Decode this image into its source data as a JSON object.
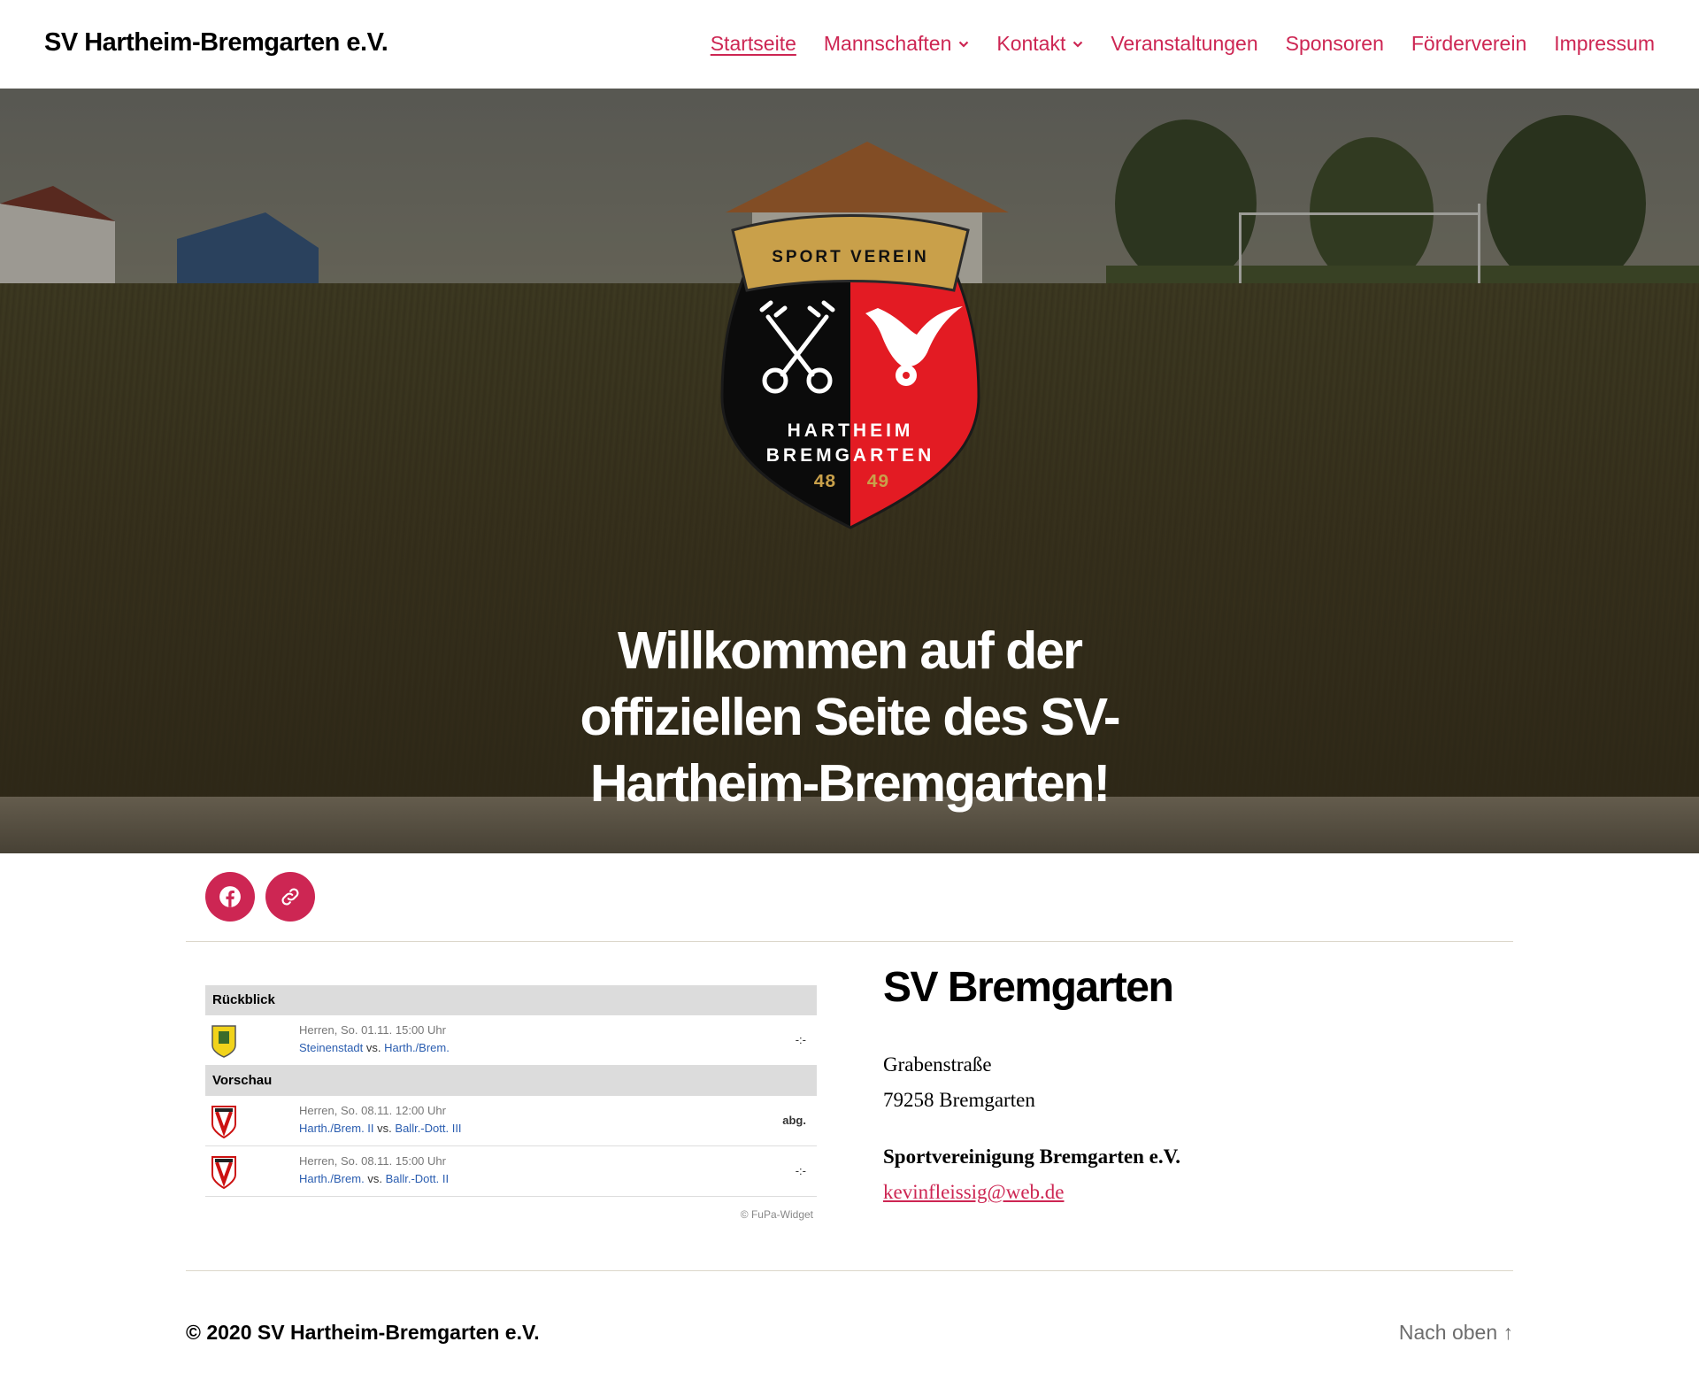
{
  "header": {
    "site_title": "SV Hartheim-Bremgarten e.V.",
    "nav": [
      {
        "label": "Startseite",
        "current": true,
        "dropdown": false
      },
      {
        "label": "Mannschaften",
        "current": false,
        "dropdown": true
      },
      {
        "label": "Kontakt",
        "current": false,
        "dropdown": true
      },
      {
        "label": "Veranstaltungen",
        "current": false,
        "dropdown": false
      },
      {
        "label": "Sponsoren",
        "current": false,
        "dropdown": false
      },
      {
        "label": "Förderverein",
        "current": false,
        "dropdown": false
      },
      {
        "label": "Impressum",
        "current": false,
        "dropdown": false
      }
    ]
  },
  "hero": {
    "crest_top_text": "SPORT VEREIN",
    "crest_line1": "HARTHEIM",
    "crest_line2": "BREMGARTEN",
    "crest_year_left": "48",
    "crest_year_right": "49",
    "title_line1": "Willkommen auf der",
    "title_line2": "offiziellen Seite des SV-",
    "title_line3": "Hartheim-Bremgarten!"
  },
  "social": {
    "facebook_icon": "facebook-icon",
    "link_icon": "link-icon"
  },
  "widget": {
    "section_past": "Rückblick",
    "section_future": "Vorschau",
    "past": [
      {
        "meta": "Herren, So. 01.11. 15:00 Uhr",
        "home": "Steinenstadt",
        "vs": "vs.",
        "away": "Harth./Brem.",
        "result": "-:-"
      }
    ],
    "future": [
      {
        "meta": "Herren, So. 08.11. 12:00 Uhr",
        "home": "Harth./Brem. II",
        "vs": "vs.",
        "away": "Ballr.-Dott. III",
        "result": "abg."
      },
      {
        "meta": "Herren, So. 08.11. 15:00 Uhr",
        "home": "Harth./Brem.",
        "vs": "vs.",
        "away": "Ballr.-Dott. II",
        "result": "-:-"
      }
    ],
    "footer": "© FuPa-Widget"
  },
  "contact": {
    "title": "SV Bremgarten",
    "street": "Grabenstraße",
    "city": "79258 Bremgarten",
    "org": "Sportvereinigung Bremgarten e.V.",
    "email": "kevinfleissig@web.de"
  },
  "footer": {
    "copyright": "© 2020 SV Hartheim-Bremgarten e.V.",
    "back_to_top": "Nach oben ↑"
  },
  "colors": {
    "accent": "#cd2653",
    "crest_red": "#e31b23",
    "crest_gold": "#c9a04a"
  }
}
